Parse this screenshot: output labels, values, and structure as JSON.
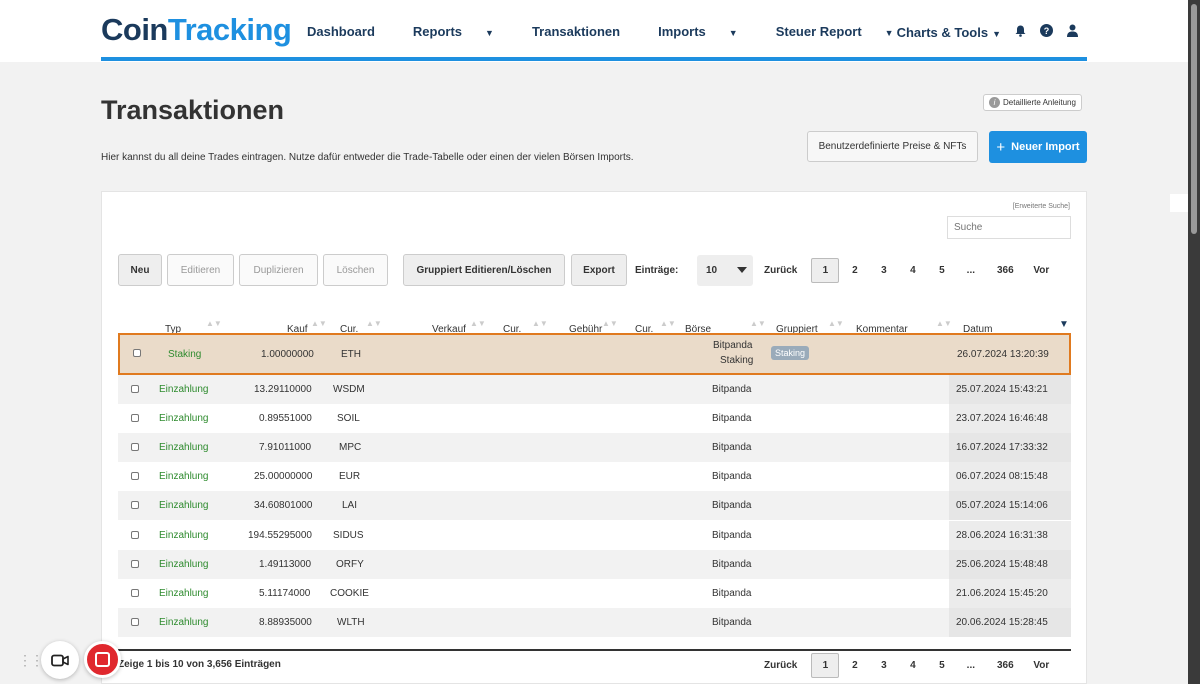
{
  "header": {
    "logo_part1": "Coin",
    "logo_part2": "Tracking",
    "nav": [
      {
        "label": "Dashboard",
        "caret": ""
      },
      {
        "label": "Reports",
        "caret": "▼"
      },
      {
        "label": "Transaktionen",
        "caret": ""
      },
      {
        "label": "Imports",
        "caret": "▼"
      },
      {
        "label": "Steuer Report",
        "caret": "▼"
      }
    ],
    "charts_tools": "Charts & Tools",
    "charts_caret": "▼",
    "icons": [
      "bell-icon",
      "help-icon",
      "user-icon"
    ]
  },
  "page": {
    "title": "Transaktionen",
    "description": "Hier kannst du all deine Trades eintragen. Nutze dafür entweder die Trade-Tabelle oder einen der vielen Börsen Imports.",
    "help_label": "Detaillierte Anleitung",
    "custom_prices_label": "Benutzerdefinierte Preise & NFTs",
    "new_import_label": "Neuer Import",
    "new_import_icon": "+"
  },
  "search": {
    "advanced_label": "[Erweiterte Suche]",
    "placeholder": "Suche"
  },
  "toolbar": {
    "new": "Neu",
    "edit": "Editieren",
    "duplicate": "Duplizieren",
    "delete": "Löschen",
    "group_edit": "Gruppiert Editieren/Löschen",
    "export": "Export",
    "entries_label": "Einträge:",
    "entries_value": "10"
  },
  "pagination": {
    "prev": "Zurück",
    "pages": [
      "1",
      "2",
      "3",
      "4",
      "5",
      "...",
      "366"
    ],
    "current": "1",
    "next": "Vor"
  },
  "columns": {
    "typ": "Typ",
    "kauf": "Kauf",
    "cur1": "Cur.",
    "verkauf": "Verkauf",
    "cur2": "Cur.",
    "gebuehr": "Gebühr",
    "cur3": "Cur.",
    "boerse": "Börse",
    "gruppiert": "Gruppiert",
    "kommentar": "Kommentar",
    "datum": "Datum",
    "sort_glyph": "▲▼",
    "sort_active": "▼"
  },
  "rows": [
    {
      "type": "Staking",
      "buy": "1.00000000",
      "cur": "ETH",
      "exchange": "Bitpanda",
      "exchange2": "Staking",
      "group": "Staking",
      "date": "26.07.2024 13:20:39"
    },
    {
      "type": "Einzahlung",
      "buy": "13.29110000",
      "cur": "WSDM",
      "exchange": "Bitpanda",
      "date": "25.07.2024 15:43:21"
    },
    {
      "type": "Einzahlung",
      "buy": "0.89551000",
      "cur": "SOIL",
      "exchange": "Bitpanda",
      "date": "23.07.2024 16:46:48"
    },
    {
      "type": "Einzahlung",
      "buy": "7.91011000",
      "cur": "MPC",
      "exchange": "Bitpanda",
      "date": "16.07.2024 17:33:32"
    },
    {
      "type": "Einzahlung",
      "buy": "25.00000000",
      "cur": "EUR",
      "exchange": "Bitpanda",
      "date": "06.07.2024 08:15:48"
    },
    {
      "type": "Einzahlung",
      "buy": "34.60801000",
      "cur": "LAI",
      "exchange": "Bitpanda",
      "date": "05.07.2024 15:14:06"
    },
    {
      "type": "Einzahlung",
      "buy": "194.55295000",
      "cur": "SIDUS",
      "exchange": "Bitpanda",
      "date": "28.06.2024 16:31:38"
    },
    {
      "type": "Einzahlung",
      "buy": "1.49113000",
      "cur": "ORFY",
      "exchange": "Bitpanda",
      "date": "25.06.2024 15:48:48"
    },
    {
      "type": "Einzahlung",
      "buy": "5.11174000",
      "cur": "COOKIE",
      "exchange": "Bitpanda",
      "date": "21.06.2024 15:45:20"
    },
    {
      "type": "Einzahlung",
      "buy": "8.88935000",
      "cur": "WLTH",
      "exchange": "Bitpanda",
      "date": "20.06.2024 15:28:45"
    }
  ],
  "footer": {
    "summary": "Zeige 1 bis 10 von 3,656 Einträgen"
  },
  "recorder": {
    "icons": [
      "drag-handle-icon",
      "camera-icon",
      "record-stop-icon"
    ]
  }
}
